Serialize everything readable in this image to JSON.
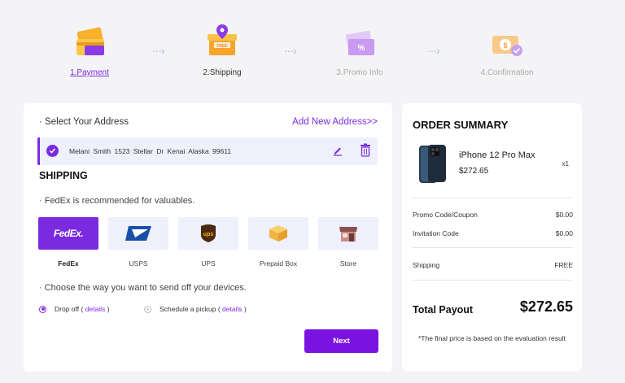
{
  "steps": [
    {
      "label": "1.Payment",
      "state": "done",
      "icon": "credit-card-icon"
    },
    {
      "label": "2.Shipping",
      "state": "active",
      "icon": "shipping-box-icon"
    },
    {
      "label": "3.Promo Info",
      "state": "pending",
      "icon": "coupon-icon"
    },
    {
      "label": "4.Confirmation",
      "state": "pending",
      "icon": "money-check-icon"
    }
  ],
  "address": {
    "section_label": "· Select Your Address",
    "add_link": "Add New Address>>",
    "text": "Melani Smith   1523 Stellar Dr Kenai Alaska   99611"
  },
  "shipping": {
    "title": "SHIPPING",
    "note": "· FedEx is recommended for valuables.",
    "carriers": [
      {
        "name": "FedEx",
        "logo_text": "FedEx.",
        "selected": true
      },
      {
        "name": "USPS",
        "selected": false
      },
      {
        "name": "UPS",
        "logo_text": "ups",
        "selected": false
      },
      {
        "name": "Prepaid Box",
        "selected": false
      },
      {
        "name": "Store",
        "selected": false
      }
    ],
    "method_prompt": "· Choose the way you want to send off your devices.",
    "options": [
      {
        "label": "Drop off",
        "details": "details",
        "selected": true
      },
      {
        "label": "Schedule a pickup",
        "details": "details",
        "selected": false
      }
    ],
    "next_label": "Next"
  },
  "summary": {
    "title": "ORDER SUMMARY",
    "product": {
      "name": "iPhone 12 Pro Max",
      "price": "$272.65",
      "qty": "x1"
    },
    "rows": [
      {
        "label": "Promo Code/Coupon",
        "value": "$0.00"
      },
      {
        "label": "Invitation Code",
        "value": "$0.00"
      },
      {
        "label": "Shipping",
        "value": "FREE"
      }
    ],
    "total_label": "Total Payout",
    "total_value": "$272.65",
    "note": "*The final price is based on the evaluation result"
  },
  "colors": {
    "accent": "#7a2be0",
    "button": "#7a12e0",
    "tile": "#eef0fb"
  }
}
